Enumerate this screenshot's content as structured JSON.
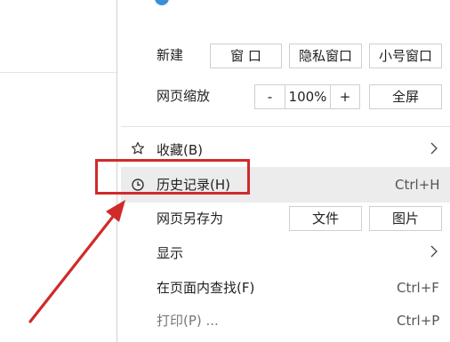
{
  "menu": {
    "new_row": {
      "label": "新建",
      "window_label": "窗 口",
      "private_window_label": "隐私窗口",
      "small_window_label": "小号窗口"
    },
    "zoom_row": {
      "label": "网页缩放",
      "minus_label": "-",
      "zoom_value": "100%",
      "plus_label": "+",
      "fullscreen_label": "全屏"
    },
    "favorites": {
      "label": "收藏(B)",
      "icon": "star-icon",
      "chevron": ">"
    },
    "history": {
      "label": "历史记录(H)",
      "icon": "clock-icon",
      "shortcut": "Ctrl+H"
    },
    "save_as": {
      "label": "网页另存为",
      "file_label": "文件",
      "image_label": "图片"
    },
    "display": {
      "label": "显示",
      "chevron": ">"
    },
    "find": {
      "label": "在页面内查找(F)",
      "shortcut": "Ctrl+F"
    },
    "print": {
      "label": "打印(P) ...",
      "shortcut": "Ctrl+P"
    }
  },
  "colors": {
    "highlight_row": "#ececec",
    "annotation_red": "#d12a2a"
  }
}
